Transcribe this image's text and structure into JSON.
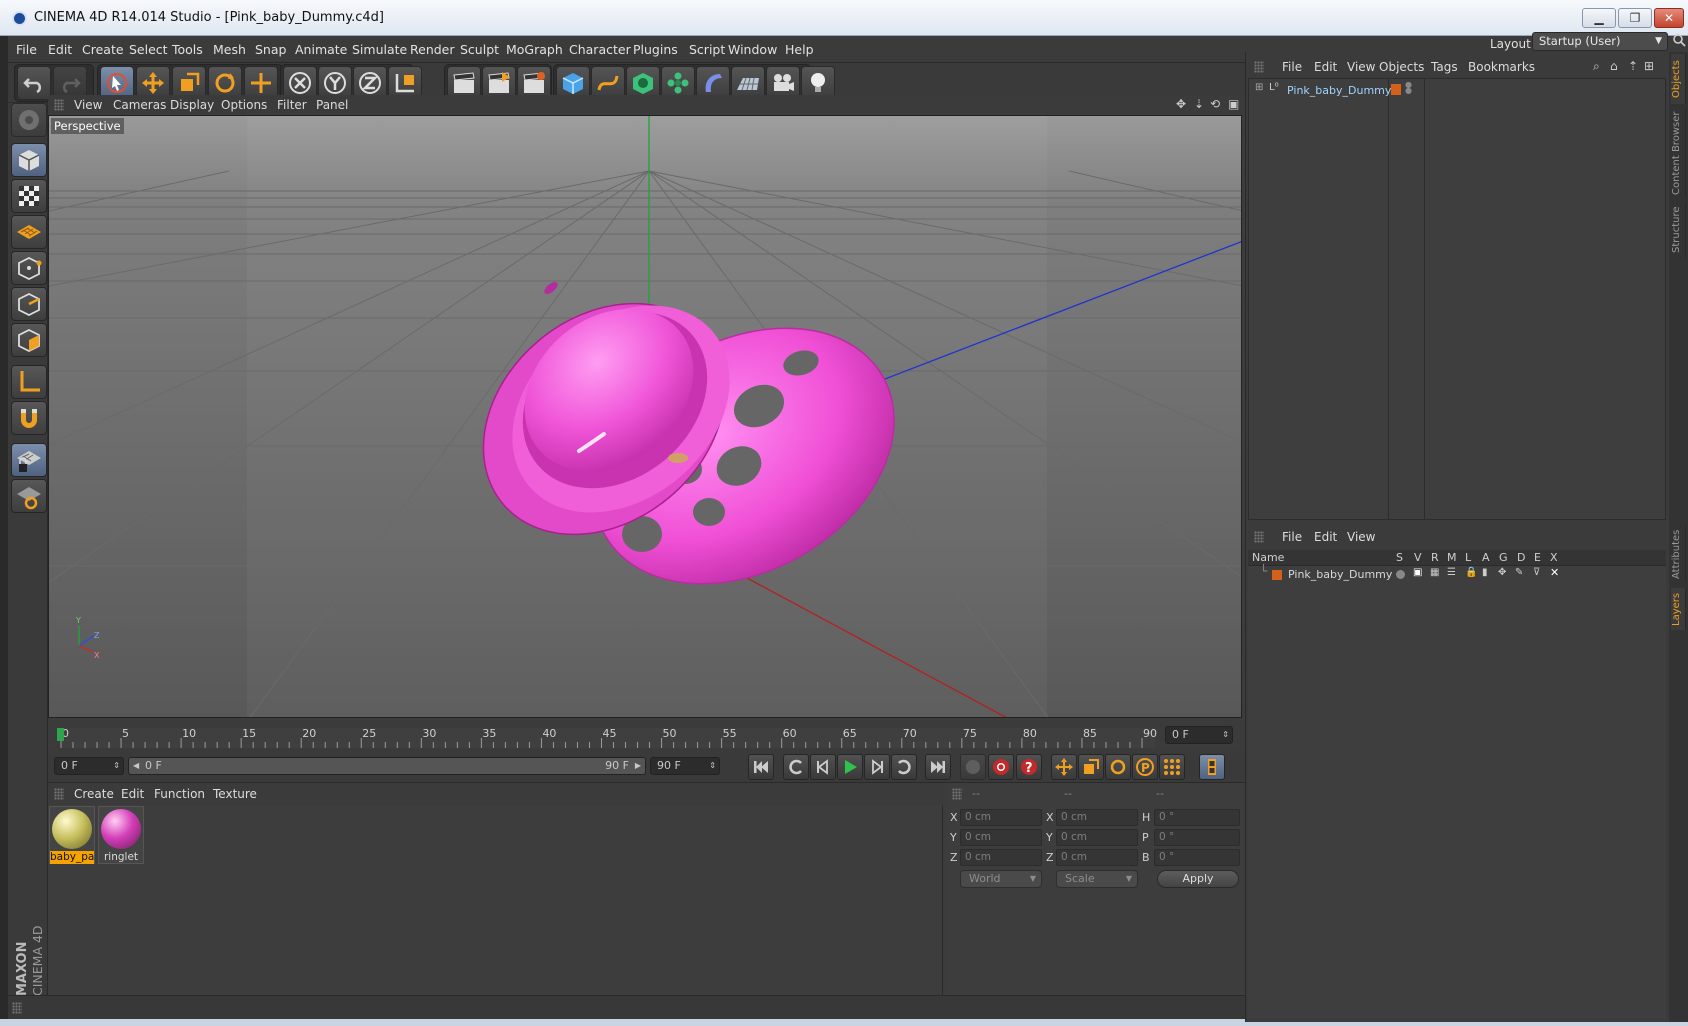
{
  "window": {
    "title": "CINEMA 4D R14.014 Studio - [Pink_baby_Dummy.c4d]"
  },
  "menubar": [
    "File",
    "Edit",
    "Create",
    "Select",
    "Tools",
    "Mesh",
    "Snap",
    "Animate",
    "Simulate",
    "Render",
    "Sculpt",
    "MoGraph",
    "Character",
    "Plugins",
    "Script",
    "Window",
    "Help"
  ],
  "layout": {
    "label": "Layout:",
    "value": "Startup (User)"
  },
  "viewport": {
    "menu": [
      "View",
      "Cameras",
      "Display",
      "Options",
      "Filter",
      "Panel"
    ],
    "label": "Perspective",
    "axis_labels": {
      "y": "Y",
      "z": "Z",
      "x": "X"
    }
  },
  "timeline": {
    "ticks": [
      "0",
      "5",
      "10",
      "15",
      "20",
      "25",
      "30",
      "35",
      "40",
      "45",
      "50",
      "55",
      "60",
      "65",
      "70",
      "75",
      "80",
      "85",
      "90"
    ],
    "current_frame": "0 F",
    "start_field": "0 F",
    "range_start": "0 F",
    "range_end": "90 F",
    "end_field": "90 F"
  },
  "materials": {
    "menu": [
      "Create",
      "Edit",
      "Function",
      "Texture"
    ],
    "items": [
      {
        "name": "baby_pa",
        "color": "#c9c060",
        "selected": true
      },
      {
        "name": "ringlet",
        "color": "#d43fb8",
        "selected": false
      }
    ]
  },
  "coords": {
    "headers": [
      "--",
      "--",
      "--"
    ],
    "rows": [
      {
        "l1": "X",
        "v1": "0 cm",
        "l2": "X",
        "v2": "0 cm",
        "l3": "H",
        "v3": "0 °"
      },
      {
        "l1": "Y",
        "v1": "0 cm",
        "l2": "Y",
        "v2": "0 cm",
        "l3": "P",
        "v3": "0 °"
      },
      {
        "l1": "Z",
        "v1": "0 cm",
        "l2": "Z",
        "v2": "0 cm",
        "l3": "B",
        "v3": "0 °"
      }
    ],
    "space": "World",
    "mode": "Scale",
    "apply": "Apply"
  },
  "objects": {
    "menu": [
      "File",
      "Edit",
      "View",
      "Objects",
      "Tags",
      "Bookmarks"
    ],
    "items": [
      {
        "name": "Pink_baby_Dummy",
        "color": "#d4601a"
      }
    ]
  },
  "layers": {
    "menu": [
      "File",
      "Edit",
      "View"
    ],
    "columns": [
      "Name",
      "S",
      "V",
      "R",
      "M",
      "L",
      "A",
      "G",
      "D",
      "E",
      "X"
    ],
    "items": [
      {
        "name": "Pink_baby_Dummy",
        "color": "#d4601a"
      }
    ]
  },
  "side_tabs": [
    "Objects",
    "Content Browser",
    "Structure",
    "Attributes",
    "Layers"
  ],
  "branding": {
    "maxon": "MAXON",
    "product": "CINEMA 4D"
  }
}
